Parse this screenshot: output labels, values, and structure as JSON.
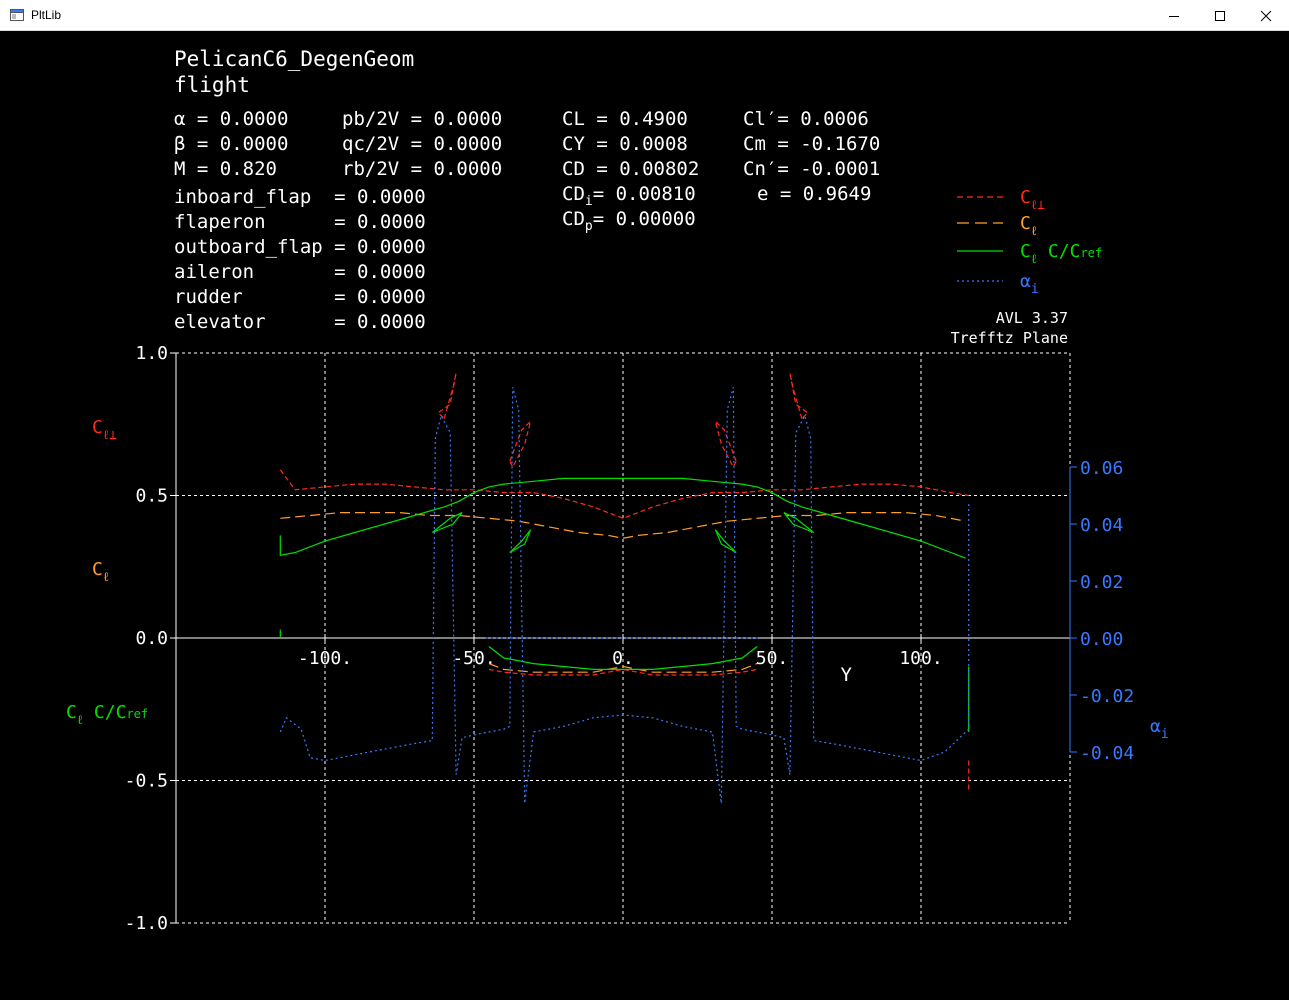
{
  "window": {
    "title": "PltLib",
    "icon": "app-window-icon",
    "controls": [
      "minimize-icon",
      "maximize-icon",
      "close-icon"
    ]
  },
  "header": {
    "title": "PelicanC6_DegenGeom",
    "subtitle": "flight",
    "params": [
      [
        "α = 0.0000",
        "pb/2V = 0.0000",
        "CL = 0.4900",
        "Cl′= 0.0006"
      ],
      [
        "β = 0.0000",
        "qc/2V = 0.0000",
        "CY = 0.0008",
        "Cm = -0.1670"
      ],
      [
        "M = 0.820",
        "rb/2V = 0.0000",
        "CD = 0.00802",
        "Cn′= -0.0001"
      ]
    ],
    "cdi": "= 0.00810",
    "e": "e = 0.9649",
    "cdp": "= 0.00000",
    "controls": [
      "inboard_flap  = 0.0000",
      "flaperon      = 0.0000",
      "outboard_flap = 0.0000",
      "aileron       = 0.0000",
      "rudder        = 0.0000",
      "elevator      = 0.0000"
    ],
    "version": "AVL 3.37",
    "view": "Trefftz Plane"
  },
  "colors": {
    "background": "#000000",
    "axis": "#ffffff",
    "cl_perp": "#ff2a1a",
    "cl": "#ff9f2a",
    "clc": "#00e000",
    "alpha_i": "#3a78ff"
  },
  "chart_data": {
    "type": "line",
    "xlabel": "Y",
    "xlim": [
      -150,
      150
    ],
    "ylim": [
      -1.0,
      1.0
    ],
    "x_ticks": [
      "-100.",
      "-50.",
      "0.",
      "50.",
      "100."
    ],
    "y_ticks": [
      "1.0",
      "0.5",
      "0.0",
      "-0.5",
      "-1.0"
    ],
    "y2_ticks": [
      "0.06",
      "0.04",
      "0.02",
      "0.00",
      "-0.02",
      "-0.04"
    ],
    "y2_range": [
      -0.05,
      0.06
    ],
    "grid": true,
    "legend_position": "top-right",
    "legend": [
      {
        "label": "C",
        "sub": "ℓ⊥",
        "color": "#ff2a1a",
        "dash": "6,4"
      },
      {
        "label": "C",
        "sub": "ℓ",
        "color": "#ff9f2a",
        "dash": "12,6"
      },
      {
        "label": "C",
        "sub": "ℓ",
        "suffix": " C/C",
        "suffix_sub": "ref",
        "color": "#00e000",
        "dash": ""
      },
      {
        "label": "α",
        "sub": "i",
        "color": "#3a78ff",
        "dash": "2,3"
      }
    ],
    "series": [
      {
        "name": "Cℓ⊥",
        "segments": [
          [
            [
              -115,
              0.59
            ],
            [
              -110,
              0.52
            ],
            [
              -100,
              0.53
            ],
            [
              -90,
              0.54
            ],
            [
              -80,
              0.54
            ],
            [
              -70,
              0.53
            ],
            [
              -60,
              0.52
            ],
            [
              -50,
              0.52
            ],
            [
              -40,
              0.51
            ],
            [
              -30,
              0.51
            ],
            [
              -20,
              0.49
            ],
            [
              -10,
              0.46
            ],
            [
              0,
              0.42
            ],
            [
              10,
              0.46
            ],
            [
              20,
              0.49
            ],
            [
              30,
              0.51
            ],
            [
              40,
              0.51
            ],
            [
              50,
              0.52
            ],
            [
              60,
              0.52
            ],
            [
              70,
              0.53
            ],
            [
              80,
              0.54
            ],
            [
              90,
              0.54
            ],
            [
              100,
              0.53
            ],
            [
              110,
              0.51
            ],
            [
              116,
              0.5
            ]
          ],
          [
            [
              -45,
              -0.11
            ],
            [
              -40,
              -0.12
            ],
            [
              -30,
              -0.13
            ],
            [
              -20,
              -0.13
            ],
            [
              -10,
              -0.13
            ],
            [
              0,
              -0.11
            ],
            [
              10,
              -0.13
            ],
            [
              20,
              -0.13
            ],
            [
              30,
              -0.13
            ],
            [
              40,
              -0.12
            ],
            [
              45,
              -0.11
            ]
          ],
          [
            [
              116,
              -0.43
            ],
            [
              116,
              -0.54
            ]
          ],
          [
            [
              -60,
              0.77
            ],
            [
              -57,
              0.88
            ],
            [
              -56,
              0.93
            ],
            [
              -58,
              0.82
            ],
            [
              -62,
              0.79
            ],
            [
              -60,
              0.77
            ]
          ],
          [
            [
              -38,
              0.62
            ],
            [
              -34,
              0.73
            ],
            [
              -31,
              0.76
            ],
            [
              -33,
              0.68
            ],
            [
              -37,
              0.6
            ],
            [
              -38,
              0.62
            ]
          ],
          [
            [
              38,
              0.62
            ],
            [
              34,
              0.73
            ],
            [
              31,
              0.76
            ],
            [
              33,
              0.68
            ],
            [
              37,
              0.6
            ],
            [
              38,
              0.62
            ]
          ],
          [
            [
              60,
              0.77
            ],
            [
              57,
              0.88
            ],
            [
              56,
              0.93
            ],
            [
              58,
              0.82
            ],
            [
              62,
              0.79
            ],
            [
              60,
              0.77
            ]
          ]
        ]
      },
      {
        "name": "Cℓ",
        "segments": [
          [
            [
              -115,
              0.42
            ],
            [
              -105,
              0.43
            ],
            [
              -95,
              0.44
            ],
            [
              -85,
              0.44
            ],
            [
              -75,
              0.44
            ],
            [
              -65,
              0.43
            ],
            [
              -55,
              0.43
            ],
            [
              -45,
              0.42
            ],
            [
              -35,
              0.41
            ],
            [
              -25,
              0.39
            ],
            [
              -15,
              0.37
            ],
            [
              -5,
              0.36
            ],
            [
              0,
              0.35
            ],
            [
              5,
              0.36
            ],
            [
              15,
              0.37
            ],
            [
              25,
              0.39
            ],
            [
              35,
              0.41
            ],
            [
              45,
              0.42
            ],
            [
              55,
              0.43
            ],
            [
              65,
              0.43
            ],
            [
              75,
              0.44
            ],
            [
              85,
              0.44
            ],
            [
              95,
              0.44
            ],
            [
              105,
              0.43
            ],
            [
              115,
              0.41
            ]
          ],
          [
            [
              -45,
              -0.09
            ],
            [
              -40,
              -0.11
            ],
            [
              -30,
              -0.12
            ],
            [
              -20,
              -0.12
            ],
            [
              -10,
              -0.12
            ],
            [
              0,
              -0.1
            ],
            [
              10,
              -0.12
            ],
            [
              20,
              -0.12
            ],
            [
              30,
              -0.12
            ],
            [
              40,
              -0.11
            ],
            [
              45,
              -0.09
            ]
          ]
        ]
      },
      {
        "name": "Cℓ C/Cref",
        "segments": [
          [
            [
              -115,
              0.36
            ],
            [
              -115,
              0.29
            ],
            [
              -110,
              0.3
            ],
            [
              -100,
              0.34
            ],
            [
              -90,
              0.37
            ],
            [
              -80,
              0.4
            ],
            [
              -70,
              0.43
            ],
            [
              -60,
              0.46
            ],
            [
              -55,
              0.48
            ],
            [
              -50,
              0.51
            ],
            [
              -45,
              0.53
            ],
            [
              -40,
              0.54
            ],
            [
              -30,
              0.55
            ],
            [
              -20,
              0.56
            ],
            [
              -10,
              0.56
            ],
            [
              0,
              0.56
            ],
            [
              10,
              0.56
            ],
            [
              20,
              0.56
            ],
            [
              30,
              0.55
            ],
            [
              40,
              0.54
            ],
            [
              45,
              0.53
            ],
            [
              50,
              0.51
            ],
            [
              55,
              0.48
            ],
            [
              60,
              0.46
            ],
            [
              70,
              0.43
            ],
            [
              80,
              0.4
            ],
            [
              90,
              0.37
            ],
            [
              100,
              0.34
            ],
            [
              110,
              0.3
            ],
            [
              115,
              0.28
            ]
          ],
          [
            [
              -45,
              -0.03
            ],
            [
              -40,
              -0.07
            ],
            [
              -30,
              -0.09
            ],
            [
              -20,
              -0.1
            ],
            [
              -10,
              -0.11
            ],
            [
              0,
              -0.11
            ],
            [
              10,
              -0.11
            ],
            [
              20,
              -0.1
            ],
            [
              30,
              -0.09
            ],
            [
              40,
              -0.07
            ],
            [
              45,
              -0.03
            ]
          ],
          [
            [
              -115,
              0.03
            ],
            [
              -115,
              0.0
            ]
          ],
          [
            [
              116,
              -0.1
            ],
            [
              116,
              -0.33
            ]
          ],
          [
            [
              -64,
              0.37
            ],
            [
              -58,
              0.42
            ],
            [
              -54,
              0.44
            ],
            [
              -57,
              0.4
            ],
            [
              -64,
              0.37
            ]
          ],
          [
            [
              -38,
              0.3
            ],
            [
              -34,
              0.34
            ],
            [
              -31,
              0.38
            ],
            [
              -33,
              0.33
            ],
            [
              -38,
              0.3
            ]
          ],
          [
            [
              38,
              0.3
            ],
            [
              34,
              0.34
            ],
            [
              31,
              0.38
            ],
            [
              33,
              0.33
            ],
            [
              38,
              0.3
            ]
          ],
          [
            [
              64,
              0.37
            ],
            [
              58,
              0.42
            ],
            [
              54,
              0.44
            ],
            [
              57,
              0.4
            ],
            [
              64,
              0.37
            ]
          ]
        ]
      },
      {
        "name": "αi",
        "segments": [
          [
            [
              -115,
              -0.33
            ],
            [
              -113,
              -0.28
            ],
            [
              -108,
              -0.32
            ],
            [
              -105,
              -0.42
            ],
            [
              -100,
              -0.43
            ],
            [
              -90,
              -0.41
            ],
            [
              -80,
              -0.39
            ],
            [
              -70,
              -0.37
            ],
            [
              -64,
              -0.36
            ],
            [
              -63,
              0.7
            ],
            [
              -61,
              0.78
            ],
            [
              -58,
              0.72
            ],
            [
              -56,
              -0.48
            ],
            [
              -54,
              -0.35
            ],
            [
              -50,
              -0.34
            ],
            [
              -45,
              -0.33
            ],
            [
              -40,
              -0.32
            ],
            [
              -38,
              -0.31
            ],
            [
              -37,
              0.88
            ],
            [
              -35,
              0.8
            ],
            [
              -33,
              -0.58
            ],
            [
              -30,
              -0.33
            ],
            [
              -20,
              -0.31
            ],
            [
              -10,
              -0.28
            ],
            [
              0,
              -0.27
            ],
            [
              10,
              -0.28
            ],
            [
              20,
              -0.31
            ],
            [
              30,
              -0.33
            ],
            [
              33,
              -0.58
            ],
            [
              35,
              0.8
            ],
            [
              37,
              0.88
            ],
            [
              38,
              -0.31
            ],
            [
              40,
              -0.32
            ],
            [
              45,
              -0.33
            ],
            [
              50,
              -0.34
            ],
            [
              54,
              -0.35
            ],
            [
              56,
              -0.48
            ],
            [
              58,
              0.72
            ],
            [
              61,
              0.78
            ],
            [
              63,
              0.7
            ],
            [
              64,
              -0.36
            ],
            [
              70,
              -0.37
            ],
            [
              80,
              -0.39
            ],
            [
              90,
              -0.41
            ],
            [
              100,
              -0.43
            ],
            [
              108,
              -0.4
            ],
            [
              112,
              -0.36
            ],
            [
              116,
              -0.32
            ],
            [
              116,
              0.47
            ]
          ],
          [
            [
              -46,
              0.0
            ],
            [
              -30,
              0.0
            ],
            [
              0,
              0.0
            ],
            [
              30,
              0.0
            ],
            [
              46,
              0.0
            ]
          ]
        ]
      }
    ]
  }
}
